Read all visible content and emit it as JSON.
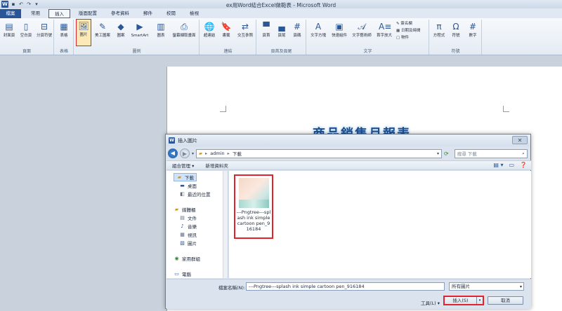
{
  "window": {
    "title": "ex用Word結合Excel做範表 - Microsoft Word",
    "logo": "W",
    "qat_icons": [
      "save-icon",
      "undo-icon",
      "redo-icon",
      "customize-icon"
    ]
  },
  "tabs": [
    "檔案",
    "常用",
    "插入",
    "版面配置",
    "參考資料",
    "郵件",
    "校閱",
    "檢視"
  ],
  "active_tab": "插入",
  "ribbon": {
    "groups": {
      "pages": {
        "name": "頁面",
        "buttons": [
          "封面頁",
          "空白頁",
          "分頁符號"
        ]
      },
      "tables": {
        "name": "表格",
        "buttons": [
          "表格"
        ]
      },
      "illustrations": {
        "name": "圖例",
        "buttons": [
          "圖片",
          "美工圖案",
          "圖案",
          "SmartArt",
          "圖表",
          "螢幕擷取畫面"
        ]
      },
      "links": {
        "name": "連結",
        "buttons": [
          "超連結",
          "書籤",
          "交互參照"
        ]
      },
      "header_footer": {
        "name": "頁首及頁尾",
        "buttons": [
          "頁首",
          "頁尾",
          "頁碼"
        ]
      },
      "text": {
        "name": "文字",
        "buttons": [
          "文字方塊",
          "快速組件",
          "文字藝術師",
          "首字放大"
        ],
        "small": [
          "簽名欄",
          "日期及時間",
          "物件"
        ]
      },
      "symbols": {
        "name": "符號",
        "buttons": [
          "方程式",
          "符號",
          "數字"
        ]
      }
    }
  },
  "document": {
    "heading": "商品銷售月報表"
  },
  "dialog": {
    "title": "插入圖片",
    "close": "✕",
    "path": [
      "admin",
      "下載"
    ],
    "search_placeholder": "搜尋 下載",
    "toolbar": [
      "組合管理",
      "新增資料夾"
    ],
    "nav_items": {
      "downloads": "下載",
      "desktop": "桌面",
      "recent": "最近的位置",
      "libraries": "媒體櫃",
      "docs": "文件",
      "music": "音樂",
      "videos": "視訊",
      "pictures": "圖片",
      "homegroup": "家用群組",
      "computer": "電腦"
    },
    "file": {
      "caption": "---Pngtree---splash ink simple cartoon pen_916184"
    },
    "filename_label": "檔案名稱(N):",
    "filename_value": "---Pngtree---splash ink simple cartoon pen_916184",
    "filetype": "所有圖片",
    "tools_label": "工具(L)",
    "insert_label": "插入(S)",
    "cancel_label": "取消"
  },
  "colors": {
    "accent_blue": "#2a5699",
    "highlight_red": "#e0242d",
    "heading_blue": "#1f4f8f"
  }
}
